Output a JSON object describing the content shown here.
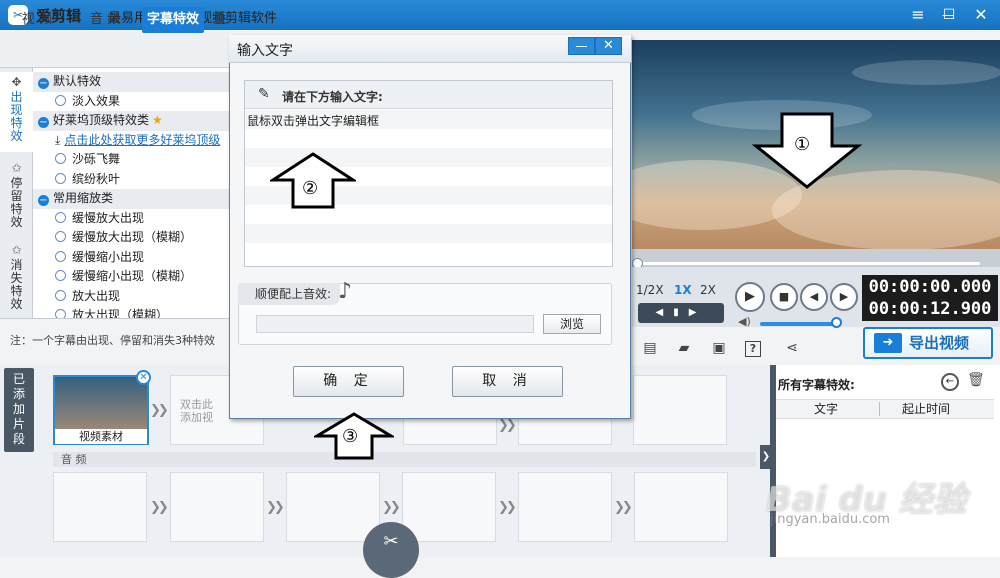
{
  "app": {
    "logo_char": "✂",
    "name": "爱剪辑",
    "slogan": "最易用、强大的视频剪辑软件"
  },
  "window_buttons": {
    "menu": "≡",
    "minimize": "—",
    "maximize": "☐",
    "close": "✕"
  },
  "tabs": [
    {
      "label": "视 频"
    },
    {
      "label": "音 频"
    },
    {
      "label": "字幕特效",
      "active": true
    },
    {
      "label": "叠"
    }
  ],
  "vtabs": [
    {
      "label": "出\n现\n特\n效",
      "icon": "✥",
      "active": true
    },
    {
      "label": "停\n留\n特\n效",
      "icon": "✩"
    },
    {
      "label": "消\n失\n特\n效",
      "icon": "✩"
    }
  ],
  "effects": [
    {
      "kind": "cat",
      "label": "默认特效"
    },
    {
      "kind": "item",
      "label": "淡入效果"
    },
    {
      "kind": "cat",
      "label": "好莱坞顶级特效类",
      "star": "★"
    },
    {
      "kind": "link",
      "label": "点击此处获取更多好莱坞顶级"
    },
    {
      "kind": "item",
      "label": "沙砾飞舞"
    },
    {
      "kind": "item",
      "label": "缤纷秋叶"
    },
    {
      "kind": "cat",
      "label": "常用缩放类"
    },
    {
      "kind": "item",
      "label": "缓慢放大出现"
    },
    {
      "kind": "item",
      "label": "缓慢放大出现（模糊）"
    },
    {
      "kind": "item",
      "label": "缓慢缩小出现"
    },
    {
      "kind": "item",
      "label": "缓慢缩小出现（模糊）"
    },
    {
      "kind": "item",
      "label": "放大出现"
    },
    {
      "kind": "item",
      "label": "放大出现（模糊）"
    }
  ],
  "hint": "注：一个字幕由出现、停留和消失3种特效",
  "player": {
    "speeds": [
      "1/2X",
      "1X",
      "2X"
    ],
    "current_time": "00:00:00.000",
    "total_time": "00:00:12.900",
    "volume_level": 0.92,
    "controls": {
      "play": "▶",
      "stop": "■",
      "prev": "◀",
      "next": "▶"
    }
  },
  "toolbar_icons": [
    {
      "name": "new-icon",
      "glyph": "▤"
    },
    {
      "name": "folder-icon",
      "glyph": "▰"
    },
    {
      "name": "save-icon",
      "glyph": "▣"
    },
    {
      "name": "help-icon",
      "glyph": "?"
    },
    {
      "name": "share-icon",
      "glyph": "⋖"
    }
  ],
  "export": {
    "label": "导出视频",
    "icon": "➜"
  },
  "timeline": {
    "added_tab": "已\n添\n加\n片\n段",
    "clip_label": "视频素材",
    "close_glyph": "✕",
    "placeholder": "双击此\n添加视",
    "audio_label": "音 频",
    "arrow_glyph": "❯❯",
    "cut_glyph": "✂"
  },
  "right_panel": {
    "title": "所有字幕特效:",
    "back_glyph": "←",
    "trash_glyph": "🗑",
    "columns": [
      "文字",
      "起止时间"
    ],
    "collapse_glyph": "❯"
  },
  "dialog": {
    "title": "输入文字",
    "min_glyph": "—",
    "close_glyph": "✕",
    "input_icon": "✎",
    "input_label": "请在下方输入文字:",
    "input_text": "鼠标双击弹出文字编辑框",
    "music_label": "顺便配上音效:",
    "music_icon": "♪",
    "browse_label": "浏览",
    "ok_label": "确 定",
    "cancel_label": "取 消"
  },
  "annotations": [
    "①",
    "②",
    "③"
  ],
  "watermark": {
    "brand": "Bai du 经验",
    "url": "jingyan.baidu.com"
  },
  "colors": {
    "accent": "#1a7ed6",
    "titlebar": "#1672c0",
    "timecode_bg": "#1c1c1c"
  }
}
